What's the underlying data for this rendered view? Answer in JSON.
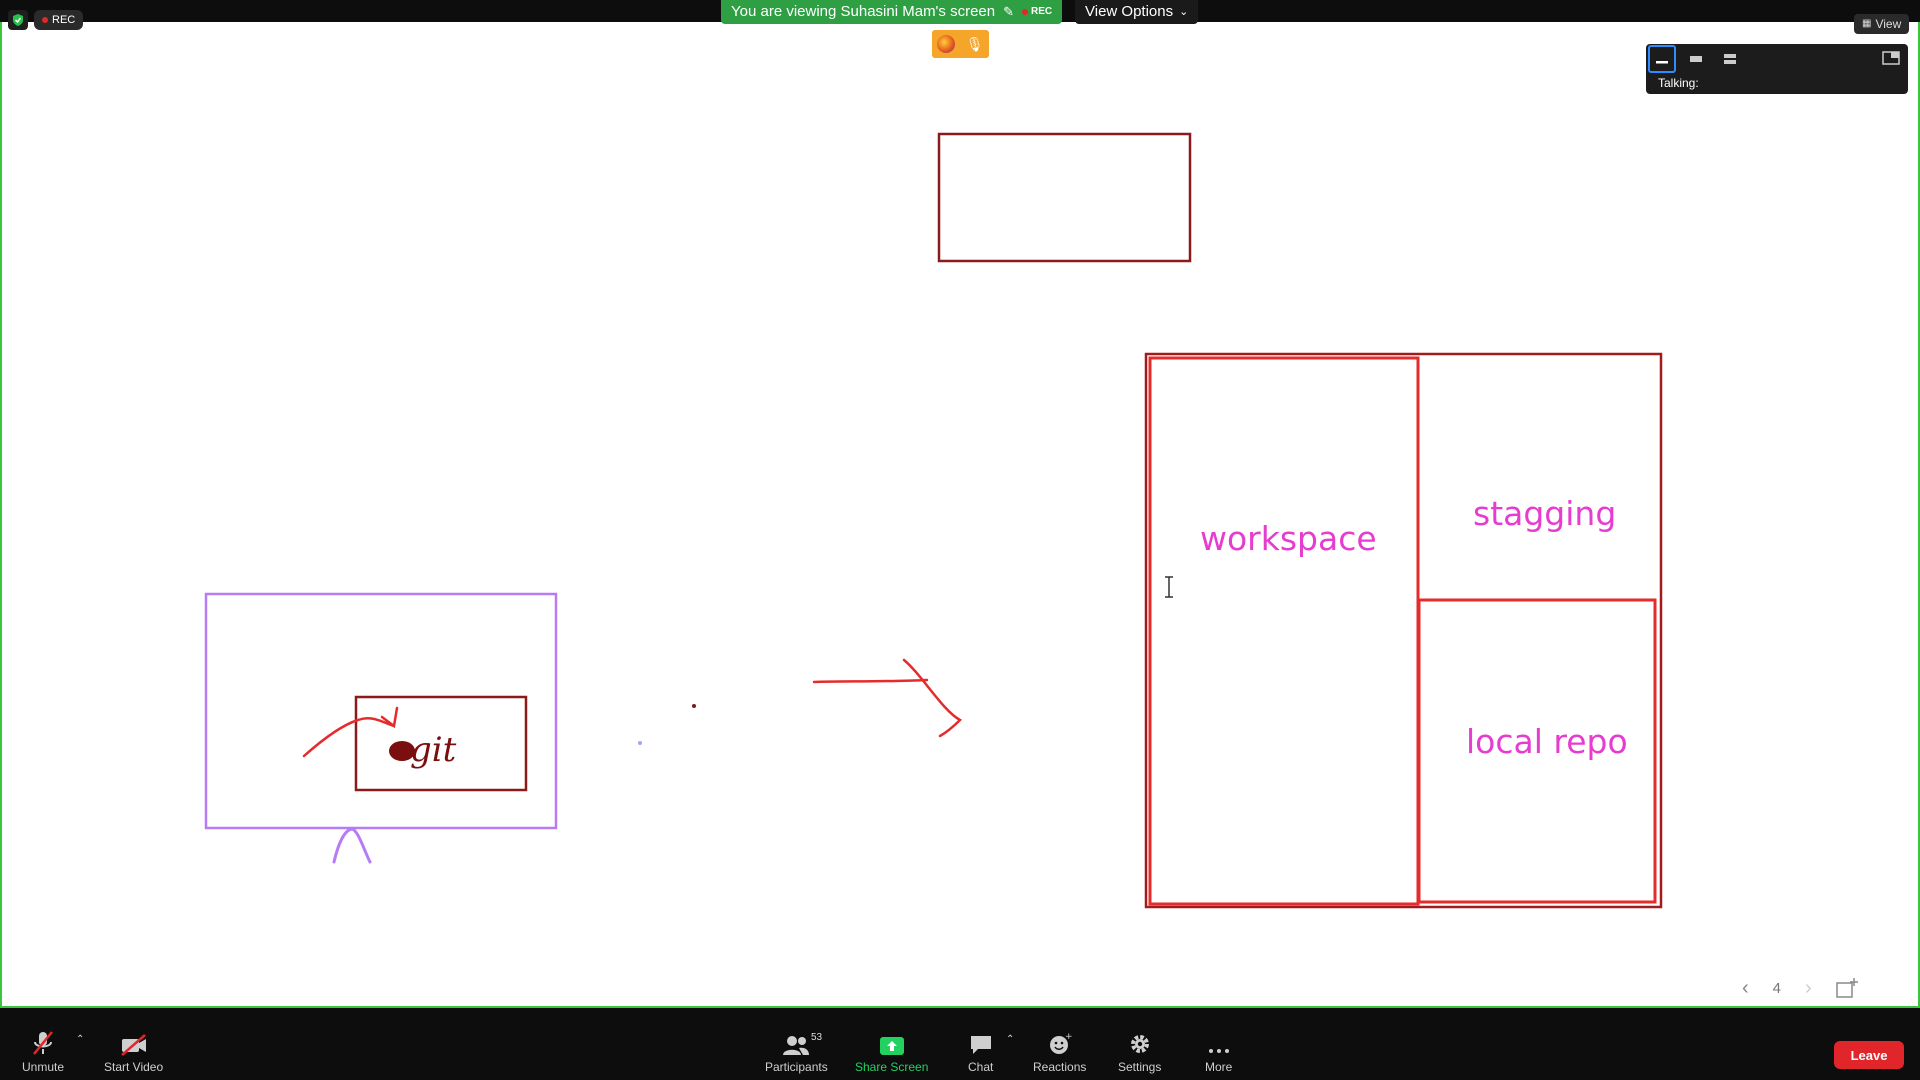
{
  "meeting": {
    "rec_label": "REC",
    "viewing_text": "You are viewing Suhasini Mam's screen",
    "banner_rec": "REC",
    "view_options": "View Options",
    "view_button": "View",
    "talking_label": "Talking:"
  },
  "whiteboard": {
    "labels": {
      "workspace": "workspace",
      "stagging": "stagging",
      "local_repo": "local repo",
      "handwriting": "git"
    }
  },
  "pager": {
    "page": "4"
  },
  "toolbar": {
    "unmute": "Unmute",
    "start_video": "Start Video",
    "participants": "Participants",
    "participants_count": "53",
    "share_screen": "Share Screen",
    "chat": "Chat",
    "reactions": "Reactions",
    "settings": "Settings",
    "more": "More",
    "leave": "Leave"
  },
  "colors": {
    "share_border": "#3cc63c",
    "banner": "#2ea043",
    "pink_text": "#e63ccf",
    "dark_red": "#8b1a1a",
    "red": "#e52b2b",
    "purple": "#b57cf5",
    "leave": "#e0252b",
    "share_icon": "#23d160"
  }
}
